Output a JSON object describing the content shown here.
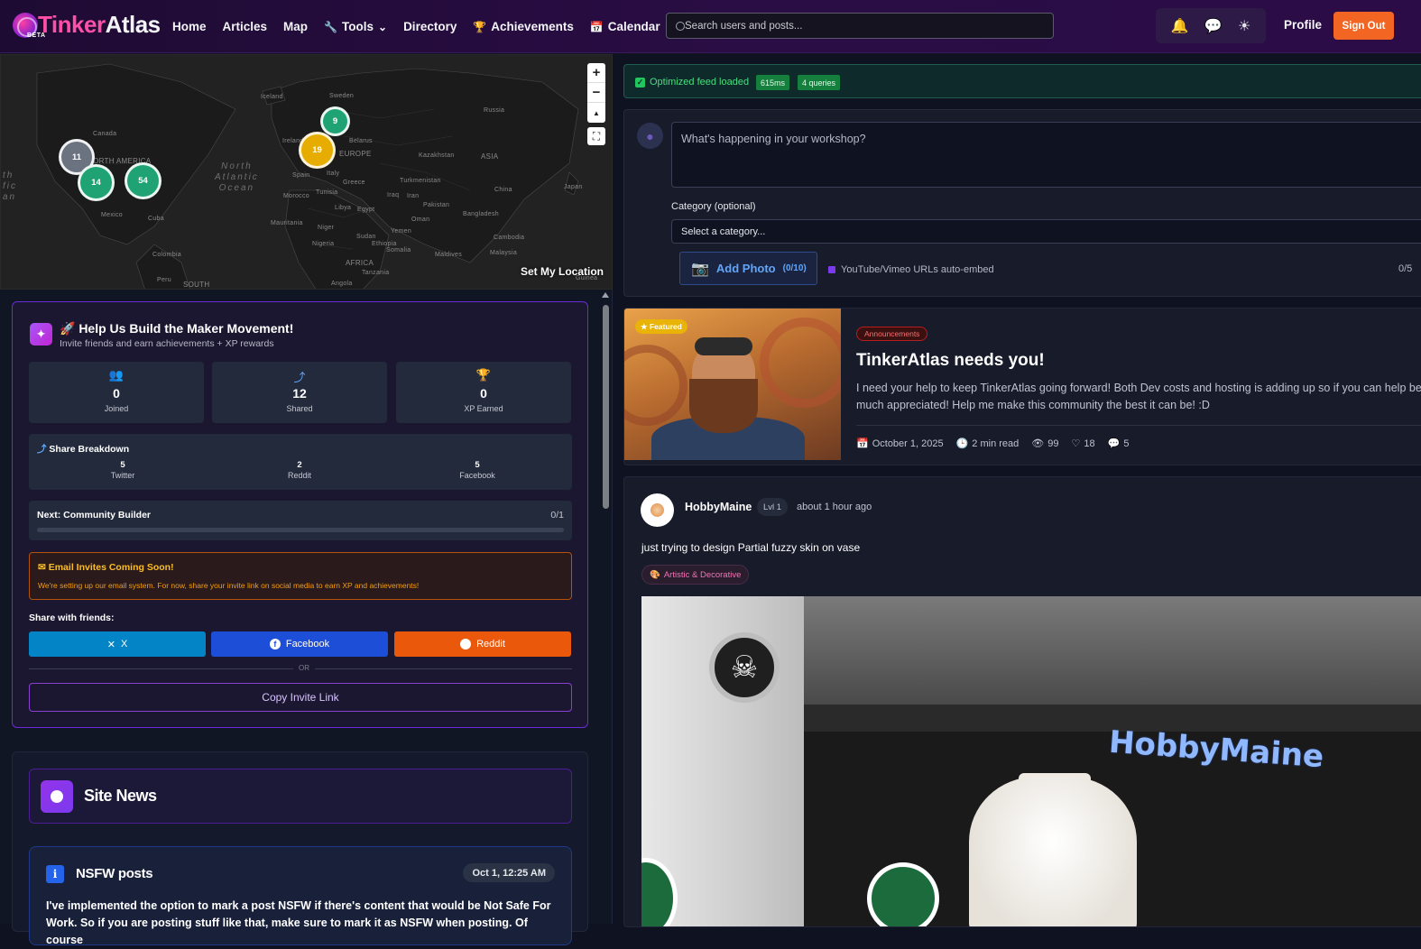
{
  "nav": {
    "logo_part1": "Tinker",
    "logo_part2": "Atlas",
    "beta": "BETA",
    "links": [
      {
        "label": "Home"
      },
      {
        "label": "Articles"
      },
      {
        "label": "Map"
      },
      {
        "label": "Tools",
        "icon": "wrench-icon"
      },
      {
        "label": "Directory"
      },
      {
        "label": "Achievements",
        "icon": "trophy-icon"
      },
      {
        "label": "Calendar",
        "icon": "calendar-icon"
      }
    ],
    "search_placeholder": "Search users and posts...",
    "icons": [
      "bell-icon",
      "chat-icon",
      "sun-icon"
    ],
    "profile": "Profile",
    "sign_out": "Sign Out",
    "sign_out_color": "#f26522"
  },
  "map": {
    "labels": {
      "iceland": "Iceland",
      "sweden": "Sweden",
      "russia": "Russia",
      "canada": "Canada",
      "ireland": "Ireland",
      "belarus": "Belarus",
      "north_america": "NORTH AMERICA",
      "ocean_atlantic": "North\nAtlantic\nOcean",
      "ocean_pacific": "th\nfic\nan",
      "spain": "Spain",
      "italy": "Italy",
      "greece": "Greece",
      "europe": "EUROPE",
      "asia": "ASIA",
      "kazakhstan": "Kazakhstan",
      "turkmenistan": "Turkmenistan",
      "china": "China",
      "japan": "Japan",
      "morocco": "Morocco",
      "tunisia": "Tunisia",
      "iraq": "Iraq",
      "iran": "Iran",
      "pakistan": "Pakistan",
      "bangladesh": "Bangladesh",
      "libya": "Libya",
      "egypt": "Egypt",
      "oman": "Oman",
      "mexico": "Mexico",
      "cuba": "Cuba",
      "mauritania": "Mauritania",
      "niger": "Niger",
      "nigeria": "Nigeria",
      "sudan": "Sudan",
      "yemen": "Yemen",
      "ethiopia": "Ethiopia",
      "somalia": "Somalia",
      "maldives": "Maldives",
      "malaysia": "Malaysia",
      "cambodia": "Cambodia",
      "colombia": "Colombia",
      "peru": "Peru",
      "south": "SOUTH",
      "angola": "Angola",
      "tanzania": "Tanzania",
      "africa": "AFRICA",
      "guinea": "Guinea"
    },
    "clusters": [
      {
        "count": "11",
        "color": "gray"
      },
      {
        "count": "14",
        "color": "green"
      },
      {
        "count": "54",
        "color": "green"
      },
      {
        "count": "9",
        "color": "green"
      },
      {
        "count": "19",
        "color": "gold"
      }
    ],
    "zoom_in": "+",
    "zoom_out": "−",
    "compass": "▲",
    "set_location": "Set My Location"
  },
  "invite": {
    "icon": "sparkle-icon",
    "title": "🚀 Help Us Build the Maker Movement!",
    "subtitle": "Invite friends and earn achievements + XP rewards",
    "stats": [
      {
        "icon": "users-icon",
        "value": "0",
        "label": "Joined",
        "color": "#a78bfa"
      },
      {
        "icon": "share-icon",
        "value": "12",
        "label": "Shared",
        "color": "#60a5fa"
      },
      {
        "icon": "trophy-icon",
        "value": "0",
        "label": "XP Earned",
        "color": "#f59e0b"
      }
    ],
    "breakdown_title": "Share Breakdown",
    "breakdown": [
      {
        "value": "5",
        "label": "Twitter"
      },
      {
        "value": "2",
        "label": "Reddit"
      },
      {
        "value": "5",
        "label": "Facebook"
      }
    ],
    "next_label": "Next: Community Builder",
    "next_count": "0/1",
    "next_progress": 0,
    "email_title": "Email Invites Coming Soon!",
    "email_sub": "We're setting up our email system. For now, share your invite link on social media to earn XP and achievements!",
    "share_with": "Share with friends:",
    "buttons": [
      {
        "label": "X",
        "color": "#0284c7"
      },
      {
        "label": "Facebook",
        "color": "#1d4ed8"
      },
      {
        "label": "Reddit",
        "color": "#ea580c"
      }
    ],
    "or": "OR",
    "copy_link": "Copy Invite Link"
  },
  "news": {
    "title": "Site News",
    "item_title": "NSFW posts",
    "item_date": "Oct 1, 12:25 AM",
    "item_body": "I've implemented the option to mark a post NSFW if there's content that would be Not Safe For Work. So if you are posting stuff like that, make sure to mark it as NSFW when posting. Of course"
  },
  "feed": {
    "optimized_label": "Optimized feed loaded",
    "optimized_ms": "615ms",
    "optimized_queries": "4 queries",
    "composer_placeholder": "What's happening in your workshop?",
    "category_label": "Category (optional)",
    "category_value": "Select a category...",
    "add_photo": "Add Photo",
    "add_photo_count": "(0/10)",
    "embed_note": "YouTube/Vimeo URLs auto-embed",
    "char_count": "0/5"
  },
  "featured": {
    "badge": "★ Featured",
    "category": "Announcements",
    "title": "TinkerAtlas needs you!",
    "body": "I need your help to keep TinkerAtlas going forward! Both Dev costs and hosting is adding up so if you can help be much appreciated! Help me make this community the best it can be! :D",
    "date": "October 1, 2025",
    "read_time": "2 min read",
    "views": "99",
    "likes": "18",
    "comments": "5"
  },
  "post": {
    "user": "HobbyMaine",
    "level": "Lvl 1",
    "time": "about 1 hour ago",
    "text": "just trying to design Partial fuzzy skin on vase",
    "tag": "Artistic & Decorative",
    "image_label": "HobbyMaine"
  }
}
